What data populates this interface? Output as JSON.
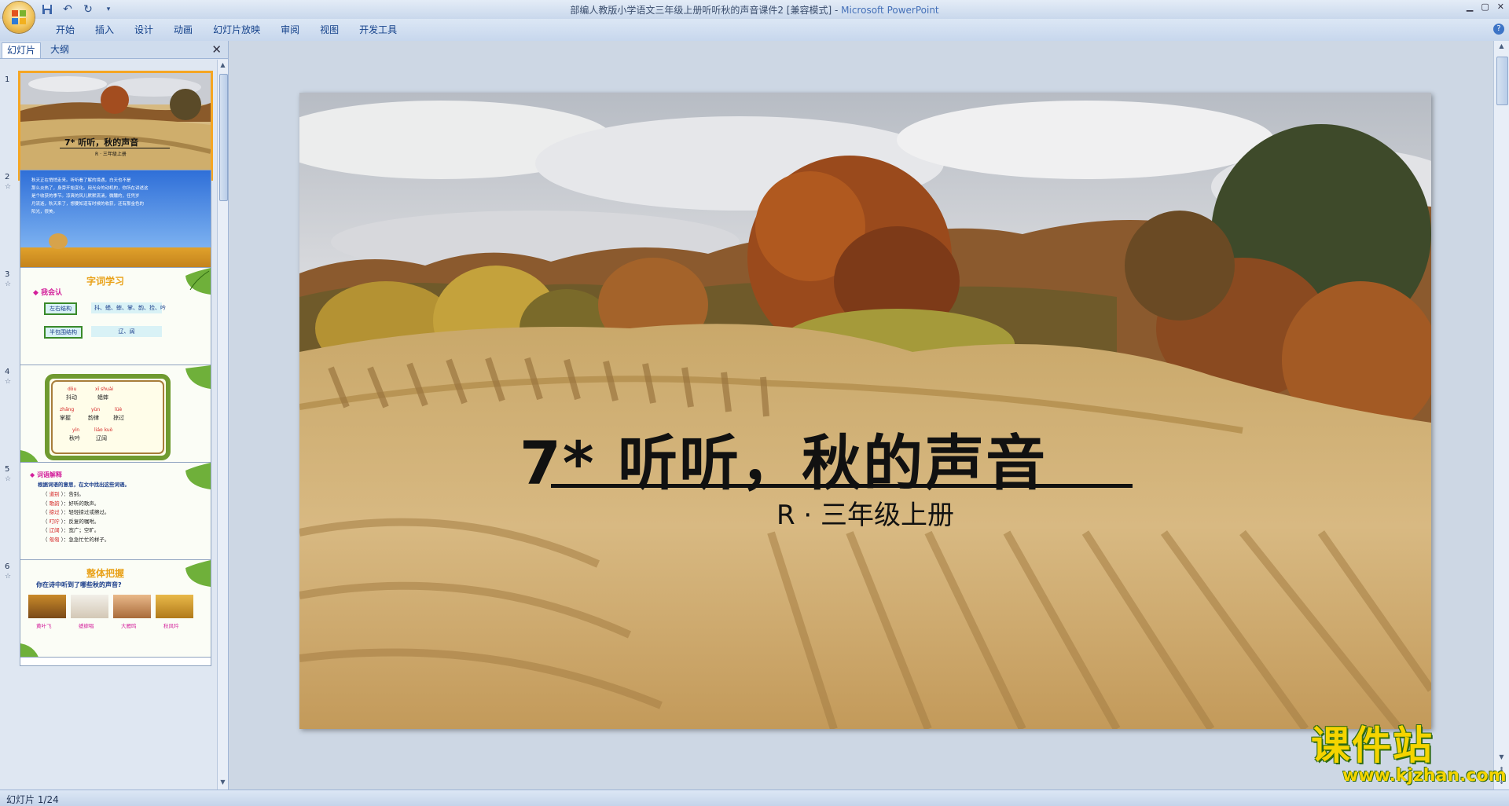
{
  "window": {
    "title": "部编人教版小学语文三年级上册听听秋的声音课件2 [兼容模式] - ",
    "app_name": "Microsoft PowerPoint"
  },
  "ribbon": {
    "tabs": [
      "开始",
      "插入",
      "设计",
      "动画",
      "幻灯片放映",
      "审阅",
      "视图",
      "开发工具"
    ]
  },
  "panel": {
    "tab_slides": "幻灯片",
    "tab_outline": "大纲"
  },
  "slides": [
    {
      "num": "1",
      "title": "7* 听听，秋的声音",
      "sub": "R · 三年级上册"
    },
    {
      "num": "2",
      "lines": [
        "秋天正在悄悄走来。听听看了解的境遇，白天也不是",
        "那么炎热了，身旁开始变化。用光合的动机的，你所在讲述这",
        "是个收获的季节。凉爽的风儿默默流淌，微醺的，任凭岁",
        "月流逝，秋天来了，想要知道有时候的收获，还有那金色的",
        "阳光，很美。"
      ]
    },
    {
      "num": "3",
      "heading": "字词学习",
      "tag": "◆ 我会认",
      "row1_label": "左右结构",
      "row1_chars": "抖、蟋、蟀、掌、韵、捡、吟",
      "row2_label": "半包围结构",
      "row2_chars": "辽、阔"
    },
    {
      "num": "4",
      "pinyin": [
        "dǒu",
        "xī shuài",
        "zhǎng",
        "yùn",
        "lüè",
        "yín",
        "liáo kuò"
      ],
      "words": [
        "抖动",
        "蟋蟀",
        "掌握",
        "韵律",
        "掠过",
        "秋吟",
        "辽阔"
      ]
    },
    {
      "num": "5",
      "heading": "◆ 词语解释",
      "instruction": "根据词语的意思，在文中找出这些词语。",
      "items": [
        {
          "word": "道别",
          "meaning": "：告别。"
        },
        {
          "word": "歌韵",
          "meaning": "：好听的歌声。"
        },
        {
          "word": "掠过",
          "meaning": "：轻轻掠过或擦过。"
        },
        {
          "word": "叮咛",
          "meaning": "：反复的嘱咐。"
        },
        {
          "word": "辽阔",
          "meaning": "：宽广；空旷。"
        },
        {
          "word": "匆匆",
          "meaning": "：急急忙忙的样子。"
        }
      ]
    },
    {
      "num": "6",
      "heading": "整体把握",
      "question": "你在诗中听到了哪些秋的声音?",
      "captions": [
        "黄叶飞",
        "蟋蟀唱",
        "大雁鸣",
        "秋风吟"
      ]
    }
  ],
  "main_slide": {
    "title": "7* 听听，秋的声音",
    "subtitle": "R · 三年级上册"
  },
  "status": {
    "text": "幻灯片 1/24"
  },
  "watermark": {
    "brand": "课件站",
    "url": "www.kjzhan.com"
  },
  "colors": {
    "ribbon": "#c7d7ed",
    "selection": "#f5a623",
    "accent_text": "#15428b"
  }
}
